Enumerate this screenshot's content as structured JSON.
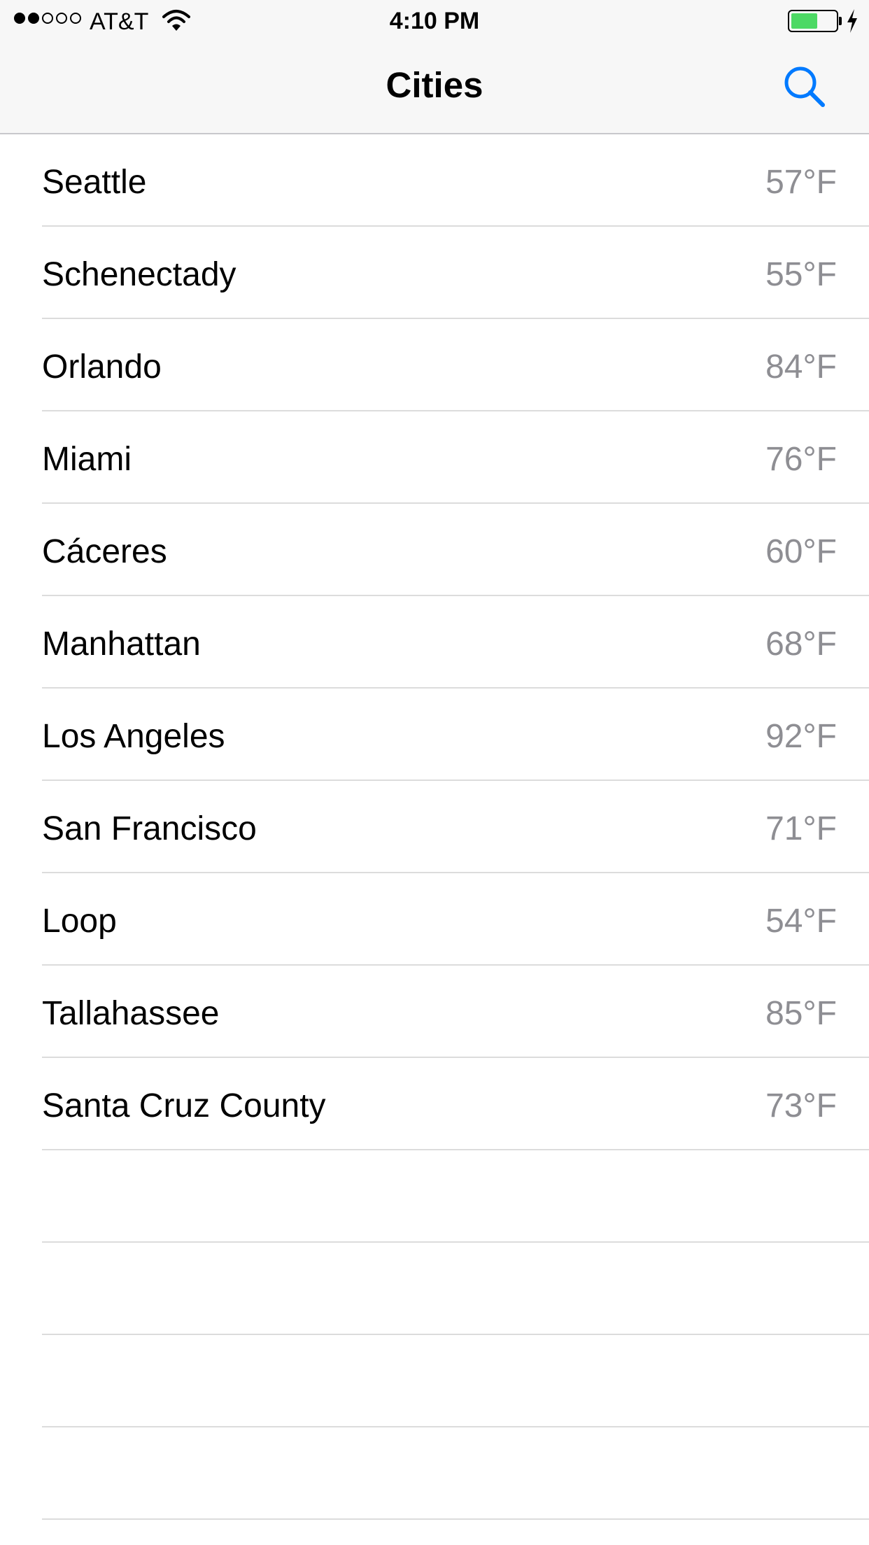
{
  "status_bar": {
    "signal": {
      "filled": 2,
      "total": 5
    },
    "carrier": "AT&T",
    "time": "4:10 PM",
    "battery_level": 0.6,
    "battery_color": "#4cd964"
  },
  "nav": {
    "title": "Cities",
    "search_icon": "search-icon",
    "accent": "#007aff"
  },
  "cities": [
    {
      "name": "Seattle",
      "temp": "57°F"
    },
    {
      "name": "Schenectady",
      "temp": "55°F"
    },
    {
      "name": "Orlando",
      "temp": "84°F"
    },
    {
      "name": "Miami",
      "temp": "76°F"
    },
    {
      "name": "Cáceres",
      "temp": "60°F"
    },
    {
      "name": "Manhattan",
      "temp": "68°F"
    },
    {
      "name": "Los Angeles",
      "temp": "92°F"
    },
    {
      "name": "San Francisco",
      "temp": "71°F"
    },
    {
      "name": "Loop",
      "temp": "54°F"
    },
    {
      "name": "Tallahassee",
      "temp": "85°F"
    },
    {
      "name": "Santa Cruz County",
      "temp": "73°F"
    }
  ]
}
